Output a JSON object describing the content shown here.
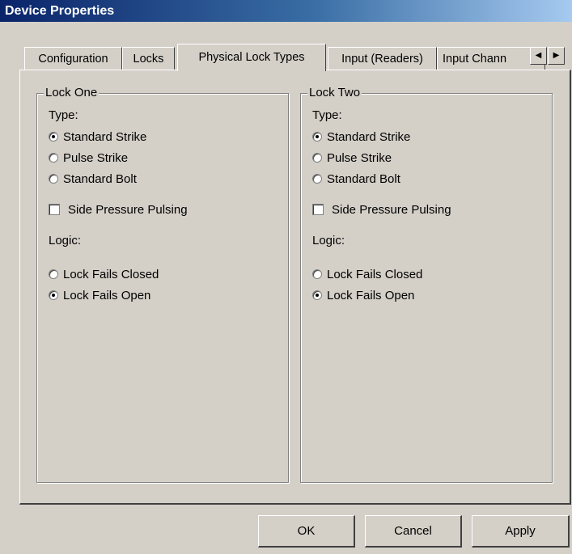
{
  "window": {
    "title": "Device Properties"
  },
  "tabs": [
    {
      "label": "Configuration"
    },
    {
      "label": "Locks"
    },
    {
      "label": "Physical Lock Types"
    },
    {
      "label": "Input (Readers)"
    },
    {
      "label": "Input Chann"
    }
  ],
  "scroll": {
    "left_icon": "arrow-left-icon",
    "right_icon": "arrow-right-icon"
  },
  "lock_one": {
    "title": "Lock One",
    "type_label": "Type:",
    "types": [
      {
        "label": "Standard Strike",
        "selected": true
      },
      {
        "label": "Pulse Strike",
        "selected": false
      },
      {
        "label": "Standard Bolt",
        "selected": false
      }
    ],
    "side_pressure": {
      "label": "Side Pressure Pulsing",
      "checked": false
    },
    "logic_label": "Logic:",
    "logic": [
      {
        "label": "Lock Fails Closed",
        "selected": false
      },
      {
        "label": "Lock Fails Open",
        "selected": true
      }
    ]
  },
  "lock_two": {
    "title": "Lock Two",
    "type_label": "Type:",
    "types": [
      {
        "label": "Standard Strike",
        "selected": true
      },
      {
        "label": "Pulse Strike",
        "selected": false
      },
      {
        "label": "Standard Bolt",
        "selected": false
      }
    ],
    "side_pressure": {
      "label": "Side Pressure Pulsing",
      "checked": false
    },
    "logic_label": "Logic:",
    "logic": [
      {
        "label": "Lock Fails Closed",
        "selected": false
      },
      {
        "label": "Lock Fails Open",
        "selected": true
      }
    ]
  },
  "buttons": {
    "ok": "OK",
    "cancel": "Cancel",
    "apply": "Apply"
  }
}
